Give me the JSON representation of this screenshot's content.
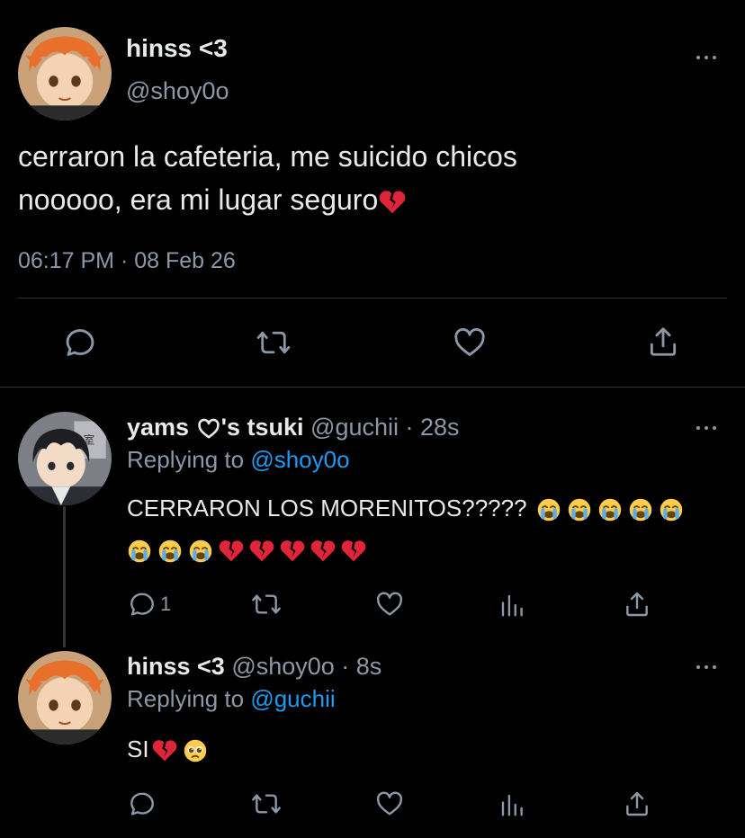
{
  "main_tweet": {
    "display_name": "hinss <3",
    "handle": "@shoy0o",
    "text_line1": "cerraron la cafeteria, me suicido chicos",
    "text_line2": "nooooo, era mi lugar seguro",
    "text_emoji": "broken-heart",
    "timestamp": "06:17 PM · 08 Feb 26",
    "actions": [
      "reply-icon",
      "retweet-icon",
      "like-icon",
      "share-icon"
    ]
  },
  "reply1": {
    "display_name_a": "yams ",
    "display_name_b": "'s tsuki",
    "handle_time": "@guchii · 28s",
    "replying_prefix": "Replying to ",
    "replying_to": "@shoy0o",
    "text": "CERRARON LOS MORENITOS?????",
    "emojis_line1": [
      "loudly-crying-face",
      "loudly-crying-face",
      "loudly-crying-face",
      "loudly-crying-face",
      "loudly-crying-face"
    ],
    "emojis_line2": [
      "loudly-crying-face",
      "loudly-crying-face",
      "loudly-crying-face",
      "broken-heart",
      "broken-heart",
      "broken-heart",
      "broken-heart",
      "broken-heart"
    ],
    "reply_count": "1"
  },
  "reply2": {
    "display_name": "hinss <3",
    "handle_time": "@shoy0o · 8s",
    "replying_prefix": "Replying to ",
    "replying_to": "@guchii",
    "text": "SI",
    "emojis": [
      "broken-heart",
      "pleading-face"
    ]
  },
  "colors": {
    "background": "#000000",
    "text": "#e7e9ea",
    "muted": "#8b98a5",
    "link": "#1d9bf0",
    "divider": "#2f3336"
  }
}
